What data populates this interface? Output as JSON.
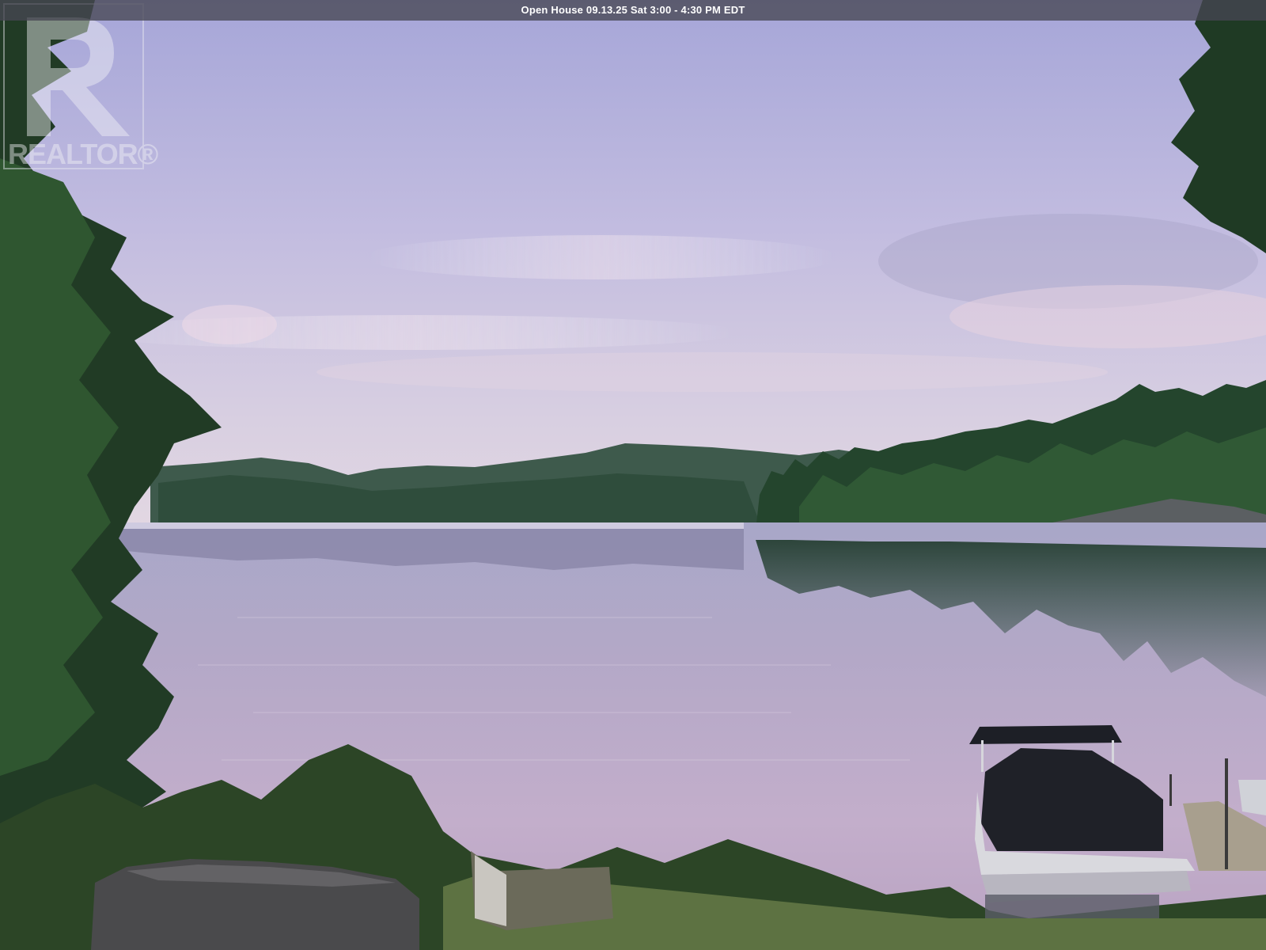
{
  "banner": {
    "text": "Open House 09.13.25 Sat 3:00 - 4:30 PM EDT"
  },
  "watermark": {
    "brand": "REALTOR®"
  },
  "scene": {
    "subject": "lake-view",
    "colors": {
      "sky_top": "#a9a7d6",
      "sky_horizon": "#ddd3df",
      "water": "#b8a9c8",
      "forest_dark": "#1f3a25",
      "forest_mid": "#2f5a34",
      "hills_far": "#3b5a4a"
    }
  }
}
